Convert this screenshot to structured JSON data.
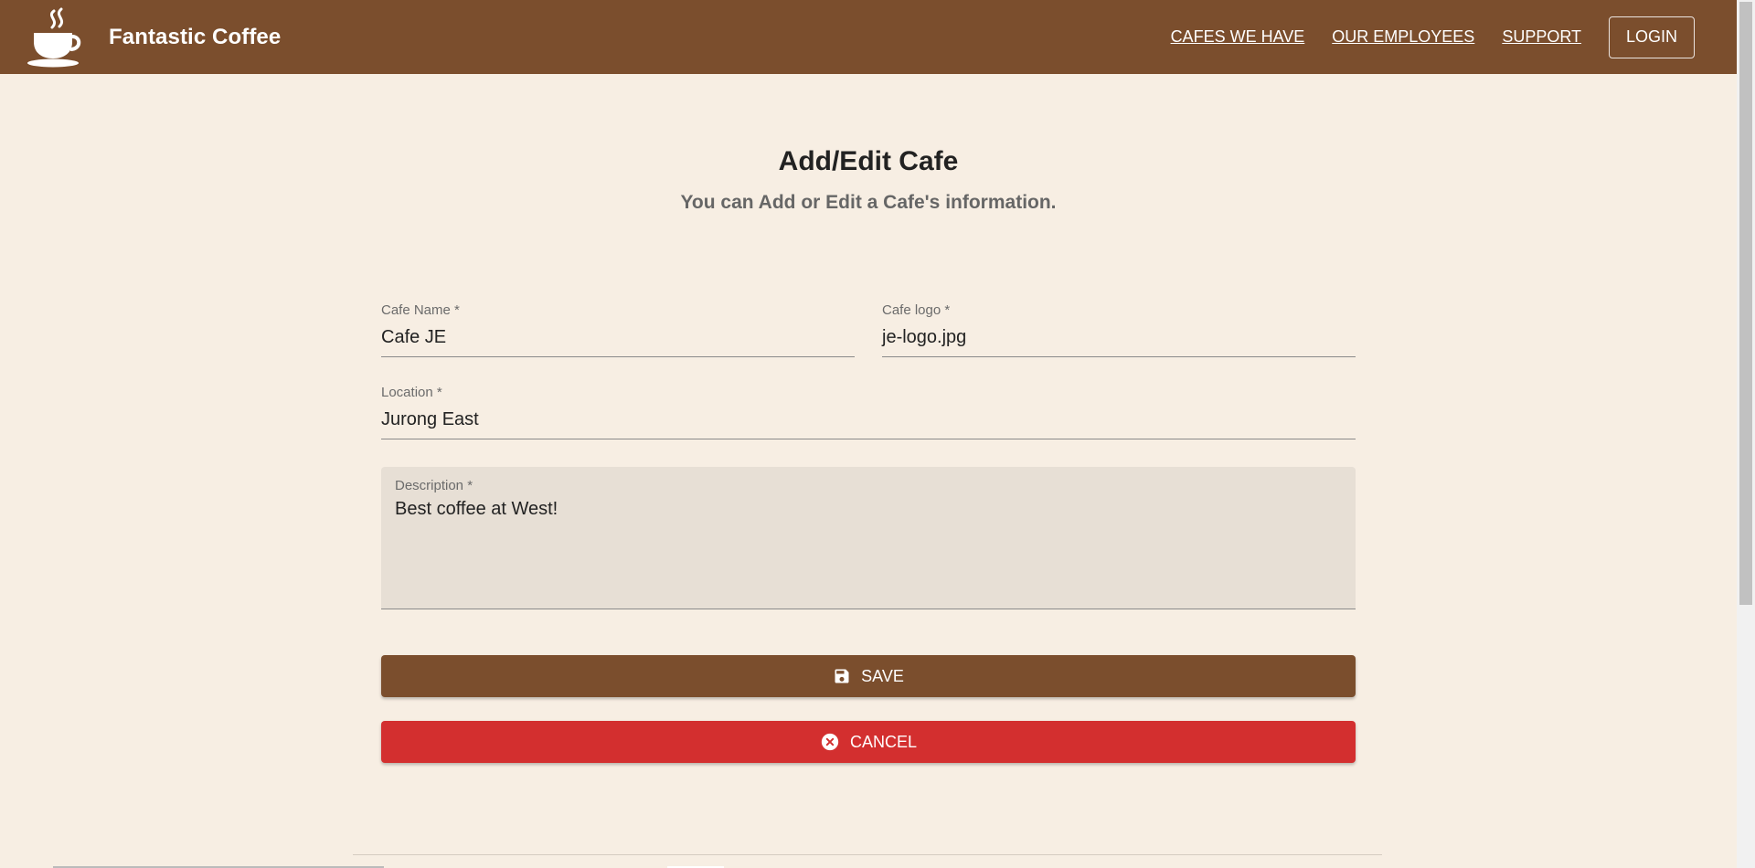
{
  "header": {
    "brand": "Fantastic Coffee",
    "nav": [
      "CAFES WE HAVE",
      "OUR EMPLOYEES",
      "SUPPORT"
    ],
    "login_label": "LOGIN"
  },
  "page": {
    "title": "Add/Edit Cafe",
    "subtitle": "You can Add or Edit a Cafe's information."
  },
  "form": {
    "name_label": "Cafe Name *",
    "name_value": "Cafe JE",
    "logo_label": "Cafe logo *",
    "logo_value": "je-logo.jpg",
    "location_label": "Location *",
    "location_value": "Jurong East",
    "description_label": "Description  *",
    "description_value": "Best coffee at West!"
  },
  "actions": {
    "save_label": "SAVE",
    "cancel_label": "CANCEL"
  },
  "icons": {
    "logo": "coffee-cup-icon",
    "save": "floppy-disk-icon",
    "cancel": "cancel-circle-icon"
  },
  "colors": {
    "primary": "#7b4e2d",
    "danger": "#d32f2f",
    "background": "#f7eee3"
  }
}
